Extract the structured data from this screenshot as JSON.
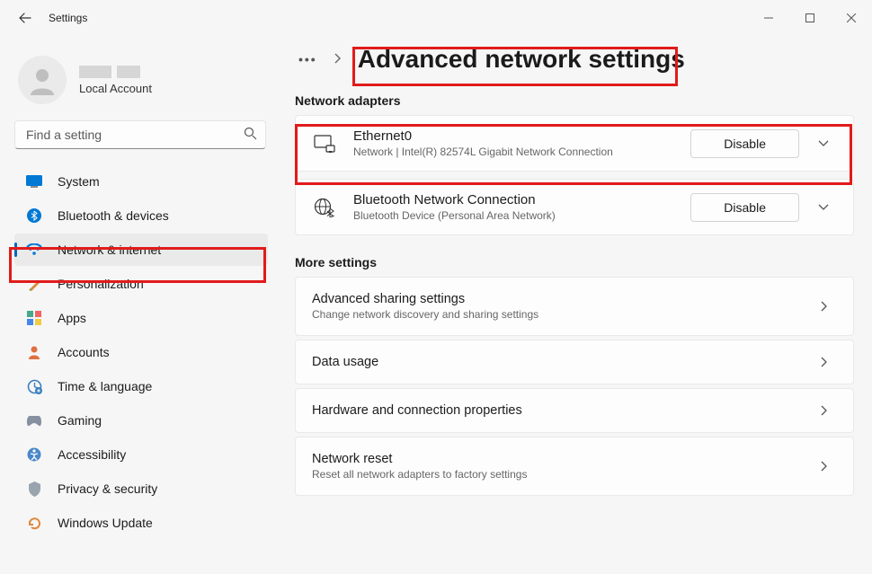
{
  "window": {
    "title": "Settings"
  },
  "profile": {
    "accountType": "Local Account"
  },
  "search": {
    "placeholder": "Find a setting"
  },
  "nav": {
    "items": [
      {
        "label": "System"
      },
      {
        "label": "Bluetooth & devices"
      },
      {
        "label": "Network & internet"
      },
      {
        "label": "Personalization"
      },
      {
        "label": "Apps"
      },
      {
        "label": "Accounts"
      },
      {
        "label": "Time & language"
      },
      {
        "label": "Gaming"
      },
      {
        "label": "Accessibility"
      },
      {
        "label": "Privacy & security"
      },
      {
        "label": "Windows Update"
      }
    ]
  },
  "breadcrumb": {
    "title": "Advanced network settings"
  },
  "sections": {
    "adaptersLabel": "Network adapters",
    "moreLabel": "More settings"
  },
  "adapters": [
    {
      "name": "Ethernet0",
      "desc": "Network | Intel(R) 82574L Gigabit Network Connection",
      "action": "Disable"
    },
    {
      "name": "Bluetooth Network Connection",
      "desc": "Bluetooth Device (Personal Area Network)",
      "action": "Disable"
    }
  ],
  "moreSettings": [
    {
      "title": "Advanced sharing settings",
      "sub": "Change network discovery and sharing settings"
    },
    {
      "title": "Data usage",
      "sub": ""
    },
    {
      "title": "Hardware and connection properties",
      "sub": ""
    },
    {
      "title": "Network reset",
      "sub": "Reset all network adapters to factory settings"
    }
  ]
}
